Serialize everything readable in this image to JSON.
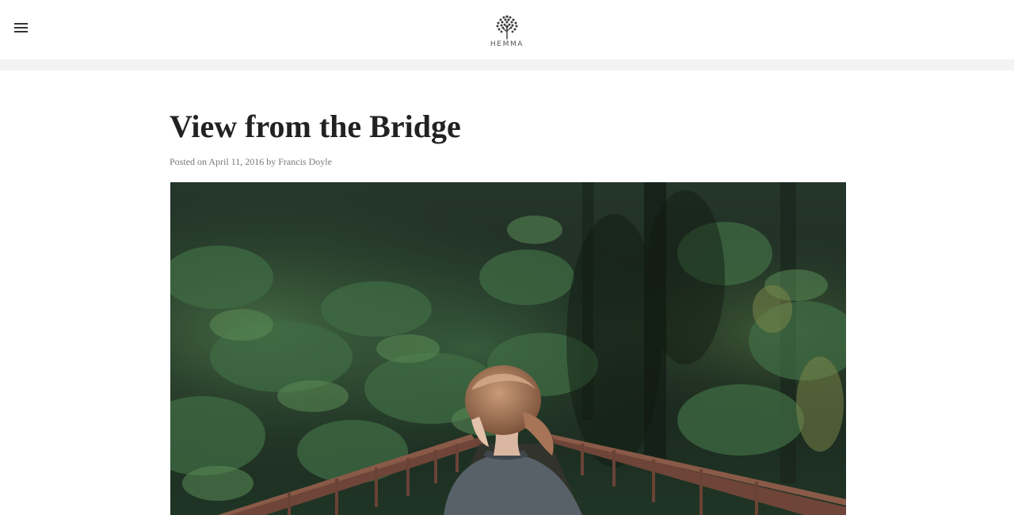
{
  "header": {
    "menu_icon": "hamburger-menu-icon",
    "logo_icon": "tree-logo-icon",
    "logo_text": "HEMMA"
  },
  "post": {
    "title": "View from the Bridge",
    "meta_prefix": "Posted on",
    "date": "April 11, 2016",
    "by": "by",
    "author": "Francis Doyle",
    "featured_image": "forest-bridge-woman-photo"
  },
  "colors": {
    "text": "#222222",
    "meta": "#777777",
    "strip": "#f3f3f3",
    "forest_dark": "#1d2a20",
    "bridge": "#7a4a3c"
  }
}
